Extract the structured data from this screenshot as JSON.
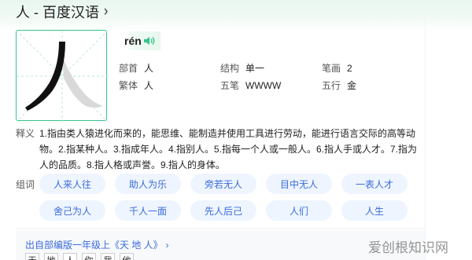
{
  "title": "人 - 百度汉语",
  "character": "人",
  "pinyin": "rén",
  "info": {
    "bushou_label": "部首",
    "bushou_value": "人",
    "jiegou_label": "结构",
    "jiegou_value": "单一",
    "bihua_label": "笔画",
    "bihua_value": "2",
    "fanti_label": "繁体",
    "fanti_value": "人",
    "wubi_label": "五笔",
    "wubi_value": "WWWW",
    "wuxing_label": "五行",
    "wuxing_value": "金"
  },
  "gloss": {
    "label": "释义",
    "lines": [
      "1.指由类人猿进化而来的，能思维、能制造并使用工具进行劳动，能进行语言交际的高等动",
      "物。2.指某种人。3.指成年人。4.指别人。5.指每一个人或一般人。6.指人手或人才。7.指为",
      "人的品质。8.指人格或声誉。9.指人的身体。"
    ]
  },
  "zuci": {
    "label": "组词",
    "words": [
      "人来人往",
      "助人为乐",
      "旁若无人",
      "目中无人",
      "一表人才",
      "舍己为人",
      "千人一面",
      "先人后己",
      "人们",
      "人生"
    ]
  },
  "source": {
    "text": "出自部编版一年级上《天 地 人》"
  },
  "poem_chars": [
    "天",
    "地",
    "人",
    "你",
    "我",
    "他"
  ],
  "watermark": "爱创根知识网",
  "colors": {
    "accent": "#36c489",
    "link": "#3b6bdd",
    "chip_bg": "#eef5ff"
  }
}
